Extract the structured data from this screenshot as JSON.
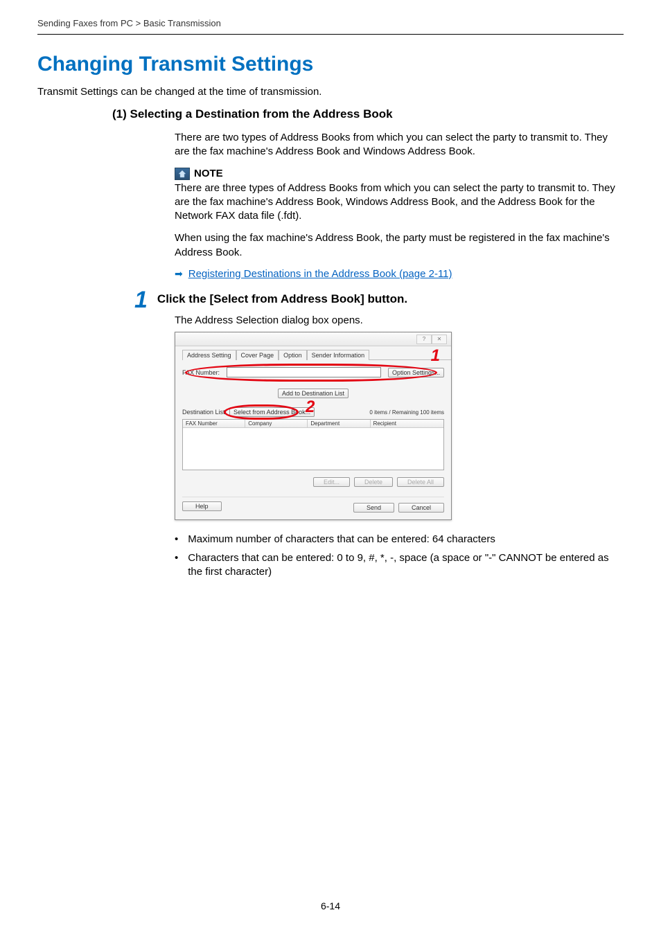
{
  "breadcrumb": "Sending Faxes from PC > Basic Transmission",
  "heading": "Changing Transmit Settings",
  "intro": "Transmit Settings can be changed at the time of transmission.",
  "section1": {
    "title": "(1) Selecting a Destination from the Address Book",
    "para1": "There are two types of Address Books from which you can select the party to transmit to. They are the fax machine's Address Book and Windows Address Book.",
    "note_label": "NOTE",
    "note_body": "There are three types of Address Books from which you can select the party to transmit to. They are the fax machine's Address Book, Windows Address Book, and the Address Book for the Network FAX data file (.fdt).",
    "para2": "When using the fax machine's Address Book, the party must be registered in the fax machine's Address Book.",
    "link_text": "Registering Destinations in the Address Book (page 2-11)"
  },
  "step": {
    "number": "1",
    "title": "Click the [Select from Address Book] button.",
    "body": "The Address Selection dialog box opens."
  },
  "dialog": {
    "tabs": [
      "Address Setting",
      "Cover Page",
      "Option",
      "Sender Information"
    ],
    "fax_label": "FAX Number:",
    "option_settings_btn": "Option Settings...",
    "add_list_btn": "Add to Destination List",
    "dest_list_label": "Destination List:",
    "select_btn": "Select from Address Book...",
    "remaining": "0 items / Remaining 100 items",
    "columns": [
      "FAX Number",
      "Company",
      "Department",
      "Recipient"
    ],
    "edit_btn": "Edit...",
    "delete_btn": "Delete",
    "delete_all_btn": "Delete All",
    "help_btn": "Help",
    "send_btn": "Send",
    "cancel_btn": "Cancel",
    "annot1": "1",
    "annot2": "2"
  },
  "bullets": {
    "b1": "Maximum number of characters that can be entered: 64 characters",
    "b2": "Characters that can be entered: 0 to 9, #, *, -, space (a space or \"-\" CANNOT be entered as the first character)"
  },
  "page_num": "6-14"
}
